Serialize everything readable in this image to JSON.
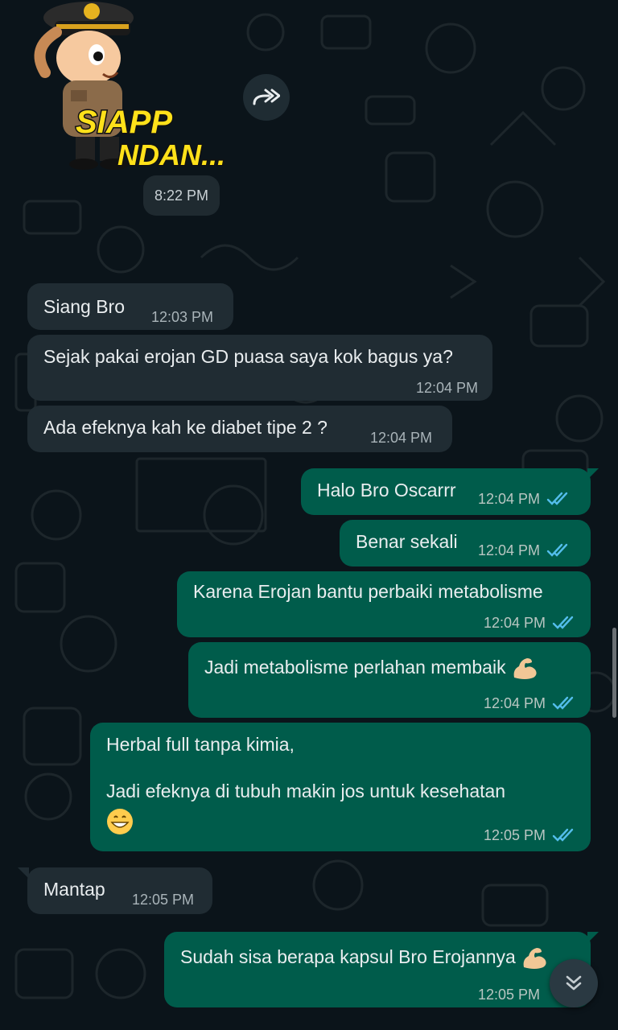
{
  "sticker": {
    "line1": "SIAPP",
    "line2": "NDAN...",
    "time": "8:22 PM",
    "forward_icon": "forward-icon"
  },
  "messages": [
    {
      "dir": "in",
      "text": "Siang Bro",
      "time": "12:03 PM"
    },
    {
      "dir": "in",
      "text": "Sejak pakai erojan GD puasa saya kok bagus ya?",
      "time": "12:04 PM"
    },
    {
      "dir": "in",
      "text": "Ada efeknya kah ke diabet tipe 2 ?",
      "time": "12:04 PM"
    },
    {
      "dir": "out",
      "text": "Halo Bro Oscarrr",
      "time": "12:04 PM",
      "status": "read"
    },
    {
      "dir": "out",
      "text": "Benar sekali",
      "time": "12:04 PM",
      "status": "read"
    },
    {
      "dir": "out",
      "text": "Karena Erojan bantu perbaiki metabolisme",
      "time": "12:04 PM",
      "status": "read"
    },
    {
      "dir": "out",
      "text": "Jadi metabolisme perlahan membaik",
      "emoji": "flexed-biceps",
      "time": "12:04 PM",
      "status": "read"
    },
    {
      "dir": "out",
      "text_line1": "Herbal full tanpa kimia,",
      "text_line2": "Jadi efeknya di tubuh makin jos untuk kesehatan",
      "emoji": "grinning-face",
      "time": "12:05 PM",
      "status": "read"
    },
    {
      "dir": "in",
      "text": "Mantap",
      "time": "12:05 PM"
    },
    {
      "dir": "out",
      "text": "Sudah sisa berapa kapsul Bro Erojannya",
      "emoji": "flexed-biceps",
      "time": "12:05 PM"
    }
  ],
  "colors": {
    "background": "#0b141a",
    "incoming": "#202c33",
    "outgoing": "#005c4b",
    "read_ticks": "#53bdeb"
  },
  "icons": {
    "scroll_down": "double-chevron-down-icon"
  }
}
